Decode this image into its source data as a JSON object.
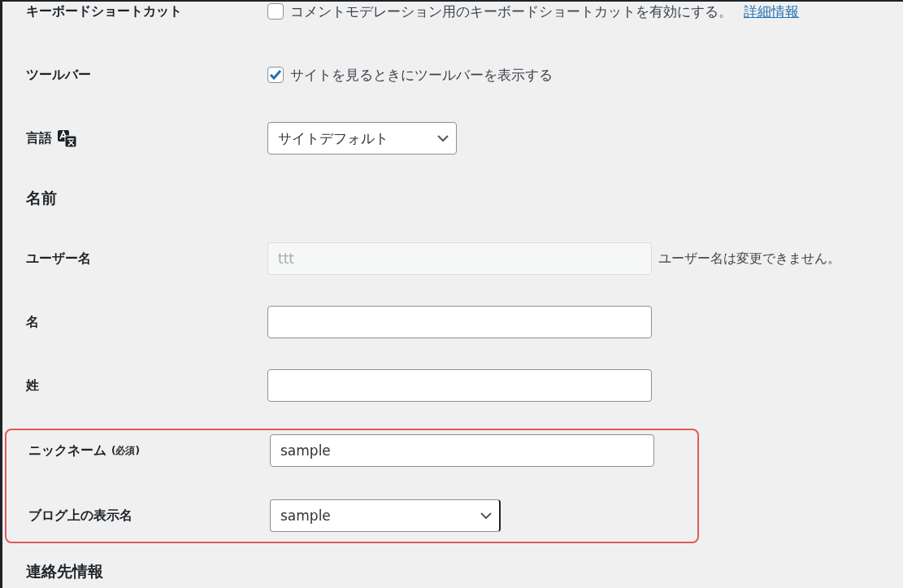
{
  "sections": [
    {
      "highlighted": false,
      "rows": [
        {
          "kind": "checkbox",
          "label": "キーボードショートカット",
          "text": "コメントモデレーション用のキーボードショートカットを有効にする。",
          "link": "詳細情報",
          "checked": false
        },
        {
          "kind": "checkbox",
          "label": "ツールバー",
          "text": "サイトを見るときにツールバーを表示する",
          "checked": true
        },
        {
          "kind": "language",
          "label": "言語",
          "value": "サイトデフォルト"
        },
        {
          "kind": "heading",
          "label": "名前"
        },
        {
          "kind": "text",
          "label": "ユーザー名",
          "value": "ttt",
          "disabled": true,
          "note": "ユーザー名は変更できません。"
        },
        {
          "kind": "text",
          "label": "名",
          "disabled": false
        },
        {
          "kind": "text",
          "label": "姓",
          "disabled": false
        }
      ]
    },
    {
      "highlighted": true,
      "rows": [
        {
          "kind": "text",
          "label": "ニックネーム",
          "required": "(必須)",
          "value": "sample",
          "disabled": false
        },
        {
          "kind": "select",
          "label": "ブログ上の表示名",
          "value": "sample"
        }
      ]
    },
    {
      "highlighted": false,
      "rows": [
        {
          "kind": "heading",
          "label": "連絡先情報"
        }
      ]
    }
  ]
}
